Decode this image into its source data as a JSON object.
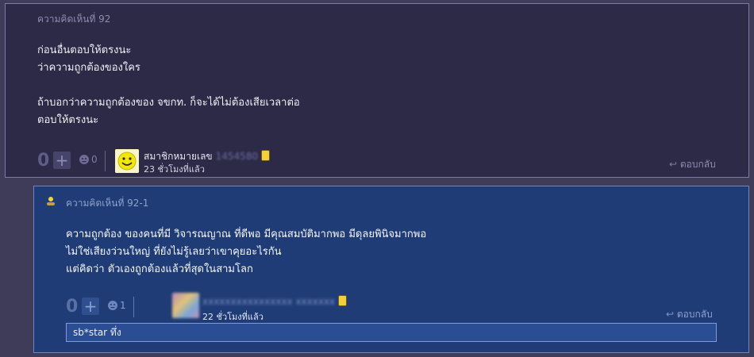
{
  "comment": {
    "header": "ความคิดเห็นที่ 92",
    "lines": [
      "ก่อนอื่นตอบให้ตรงนะ",
      "ว่าความถูกต้องของใคร",
      "",
      "ถ้าบอกว่าความถูกต้องของ จขกท. ก็จะได้ไม่ต้องเสียเวลาต่อ",
      "ตอบให้ตรงนะ"
    ],
    "score": "0",
    "plus": "+",
    "emotion_count": "0",
    "user_name": "สมาชิกหมายเลข",
    "user_id_blurred": "1454580",
    "time": "23 ชั่วโมงที่แล้ว",
    "reply_label": "ตอบกลับ",
    "icons": {
      "emotion": "emotion-icon",
      "reply": "reply-arrow-icon",
      "badge": "member-badge-icon",
      "avatar": "smiley-avatar-icon"
    }
  },
  "subcomment": {
    "header": "ความคิดเห็นที่ 92-1",
    "lines": [
      "ความถูกต้อง ของคนที่มี วิจารณญาณ ที่ดีพอ มีคุณสมบัติมากพอ มีดุลยพินิจมากพอ",
      "ไม่ใช่เสียงว่วนใหญ่ ที่ยังไม่รู้เลยว่าเขาคุยอะไรกัน",
      "แต่คิดว่า ตัวเองถูกต้องแล้วที่สุดในสามโลก"
    ],
    "score": "0",
    "plus": "+",
    "emotion_count": "1",
    "user_name_blurred": "xxxxxxxxxxxxxxxx xxxxxxx",
    "time": "22 ชั่วโมงที่แล้ว",
    "reply_label": "ตอบกลับ",
    "quote_text": "sb*star ทึ่ง",
    "icons": {
      "header": "user-icon",
      "emotion": "emotion-icon",
      "reply": "reply-arrow-icon",
      "badge": "member-badge-icon"
    }
  },
  "colors": {
    "background": "#3f3c5a",
    "comment_bg": "#2c2a47",
    "subcomment_bg": "#1f3c76"
  }
}
